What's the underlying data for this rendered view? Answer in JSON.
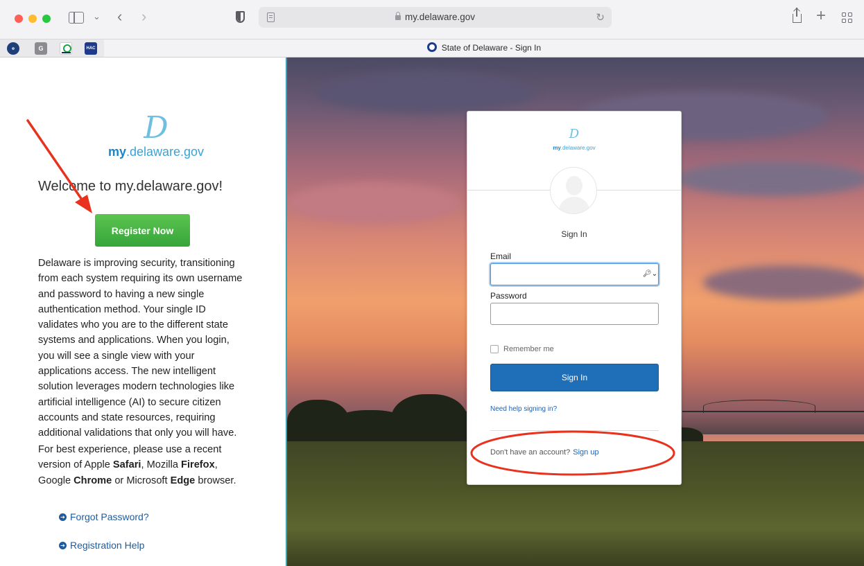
{
  "browser": {
    "url": "my.delaware.gov",
    "tab_title": "State of Delaware - Sign In",
    "favorites": [
      "G",
      "HAC"
    ]
  },
  "left": {
    "logo_prefix": "my",
    "logo_suffix": ".delaware.gov",
    "welcome": "Welcome to my.delaware.gov!",
    "register_label": "Register Now",
    "description": "Delaware is improving security, transitioning from each system requiring its own username and password to having a new single authentication method. Your single ID validates who you are to the different state systems and applications. When you login, you will see a single view with your applications access. The new intelligent solution leverages modern technologies like artificial intelligence (AI) to secure citizen accounts and state resources, requiring additional validations that only you will have.",
    "best_experience": {
      "p1": "For best experience, please use a recent version of Apple ",
      "safari": "Safari",
      "p2": ", Mozilla ",
      "firefox": "Firefox",
      "p3": ", Google ",
      "chrome": "Chrome",
      "p4": " or Microsoft ",
      "edge": "Edge",
      "p5": " browser."
    },
    "links": [
      "Forgot Password?",
      "Registration Help"
    ]
  },
  "card": {
    "logo_prefix": "my",
    "logo_suffix": ".delaware.gov",
    "title": "Sign In",
    "email_label": "Email",
    "email_value": "",
    "password_label": "Password",
    "password_value": "",
    "remember_label": "Remember me",
    "signin_label": "Sign In",
    "help_link": "Need help signing in?",
    "no_account": "Don't have an account?",
    "signup_link": "Sign up"
  },
  "colors": {
    "annotation": "#e8321e",
    "register_green": "#3fae3f",
    "signin_blue": "#1e6fb8",
    "link_blue": "#1f5b9c"
  },
  "icons": [
    "sidebar-icon",
    "chevron-down-icon",
    "back-icon",
    "forward-icon",
    "shield-icon",
    "reader-icon",
    "lock-icon",
    "reload-icon",
    "share-icon",
    "new-tab-icon",
    "tab-overview-icon",
    "key-icon",
    "arrow-circle-icon"
  ]
}
